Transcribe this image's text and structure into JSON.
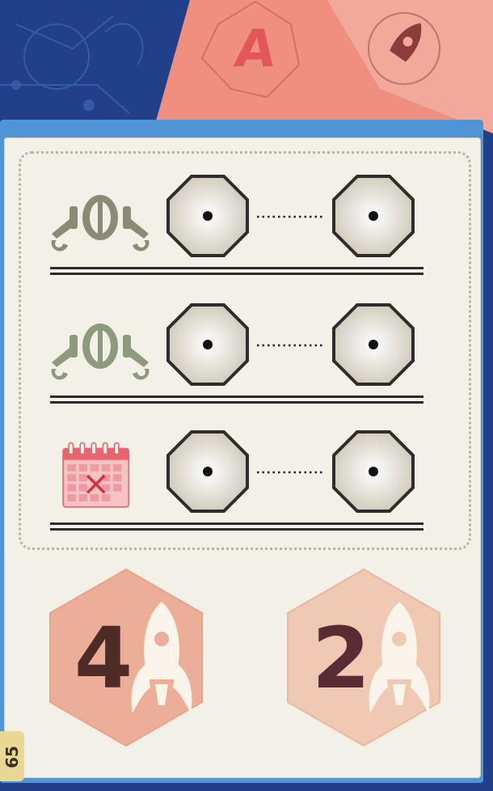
{
  "background_card": {
    "letter": "A"
  },
  "rows": [
    {
      "icon": "robot-arm-icon"
    },
    {
      "icon": "robot-arm-icon"
    },
    {
      "icon": "calendar-cross-icon"
    }
  ],
  "rewards": [
    {
      "value": "4",
      "icon": "rocket-icon",
      "hex_color": "#ecae98",
      "num_color": "#4d2b27"
    },
    {
      "value": "2",
      "icon": "rocket-icon",
      "hex_color": "#efc9b3",
      "num_color": "#5b2b34"
    }
  ],
  "page_number": "65",
  "colors": {
    "card": "#f3f0e7",
    "slot_border": "#2d2d2d",
    "background_blue": "#1f3f86",
    "salmon": "#ef8f80"
  }
}
